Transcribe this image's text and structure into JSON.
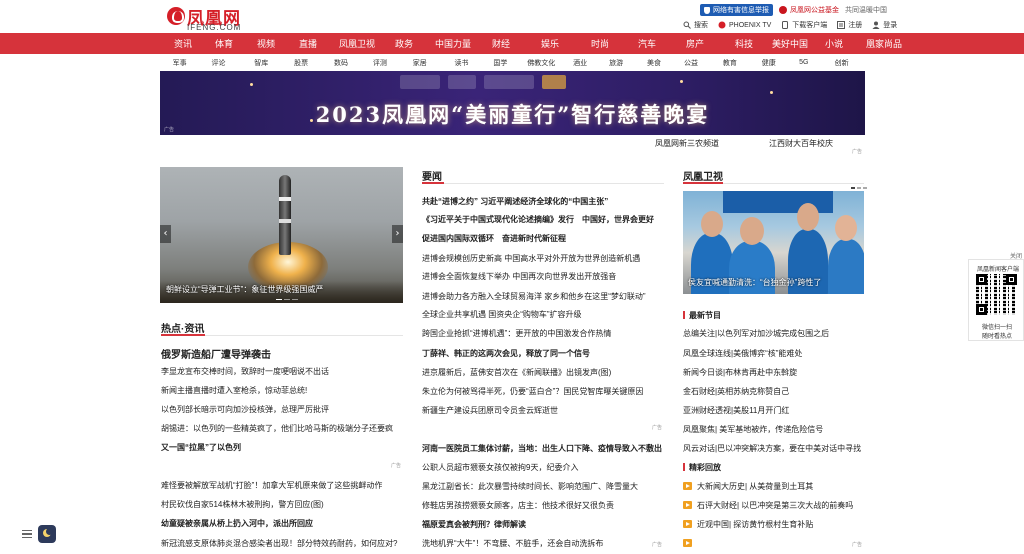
{
  "brand": {
    "logo_text": "凤凰网",
    "logo_sub": "IFENG.COM",
    "color": "#d51f28"
  },
  "top_badges": {
    "report": "网络有害信息举报",
    "fund": "凤凰网公益基金",
    "fund_sub": "共同温暖中国"
  },
  "top_links": [
    {
      "label": "搜索",
      "icon": "search-icon"
    },
    {
      "label": "PHOENIX TV",
      "icon": "phoenix-tv-icon"
    },
    {
      "label": "下载客户端",
      "icon": "download-icon"
    },
    {
      "label": "注册",
      "icon": "register-icon"
    },
    {
      "label": "登录",
      "icon": "user-icon"
    }
  ],
  "nav": [
    "资讯",
    "体育",
    "视频",
    "直播",
    "凤凰卫视",
    "政务",
    "中国力量",
    "财经",
    "娱乐",
    "时尚",
    "汽车",
    "房产",
    "科技",
    "美好中国",
    "小说",
    "凰家尚品"
  ],
  "subnav": [
    "军事",
    "评论",
    "智库",
    "股票",
    "数码",
    "评测",
    "家居",
    "读书",
    "国学",
    "佛教文化",
    "酒业",
    "旅游",
    "美食",
    "公益",
    "教育",
    "健康",
    "5G",
    "创新"
  ],
  "banner": {
    "title": "2023凤凰网“美丽童行”智行慈善晚宴",
    "ad": "广告"
  },
  "banner_links": [
    "凤凰网新三农频道",
    "江西财大百年校庆"
  ],
  "ad_label": "广告",
  "hero": {
    "caption": "朝鲜设立“导弹工业节”：象征世界级强国威严"
  },
  "hot": {
    "title": "热点·资讯",
    "items": [
      "俄罗斯造船厂遭导弹袭击",
      "李显龙宣布交棒时间，致辞时一度哽咽说不出话",
      "新闻主播直播时遭入室枪杀，惊动菲总统!",
      "以色列部长暗示可向加沙投核弹，总理严厉批评",
      "胡锡进：以色列的一些精英疯了，他们比哈马斯的极端分子还要疯",
      "又一国“拉黑”了以色列",
      "难怪要被解放军战机“打脸”！加拿大军机原来做了这些挑衅动作",
      "村民砍伐自家514株林木被刑拘，警方回应(图)",
      "幼童疑被亲属从桥上扔入河中，派出所回应",
      "新冠流感支原体肺炎混合感染者出现！部分特效药耐药，如何应对?"
    ]
  },
  "news": {
    "title": "要闻",
    "items": [
      "共赴“进博之约” 习近平阐述经济全球化的“中国主张”",
      "《习近平关于中国式现代化论述摘编》发行　中国好，世界会更好",
      "促进国内国际双循环　奋进新时代新征程",
      "进博会规模创历史新高 中国高水平对外开放为世界创造新机遇",
      "进博会全面恢复线下举办 中国再次向世界发出开放强音",
      "进博会助力各方融入全球贸易海洋 家乡和他乡在这里“梦幻联动”",
      "全球企业共享机遇 国资央企“购物车”扩容升级",
      "跨国企业抢抓“进博机遇”：更开放的中国激发合作热情",
      "丁薛祥、韩正的这两次会见，释放了同一个信号",
      "进京履新后，蓝佛安首次在《新闻联播》出镜发声(图)",
      "朱立伦为何被骂得半死，仍要“蓝白合”？国民党智库曝关键原因",
      "新疆生产建设兵团原司令员金云辉逝世",
      "河南一医院员工集体讨薪，当地：出生人口下降、疫情导致入不敷出",
      "公职人员超市猥亵女孩仅被拘9天，纪委介入",
      "黑龙江副省长：此次暴雪持续时间长、影响范围广、降雪量大",
      "修鞋店男孩捞猥亵女顾客，店主：他技术很好又很负责",
      "福原爱真会被判刑？律师解读",
      "洗地机界“大牛”！不弯腰、不脏手，还会自动洗拆布"
    ]
  },
  "tv": {
    "title": "凤凰卫视",
    "caption": "侯友宜喊通勤清洗：“台独金孙”跨性了",
    "latest_title": "最新节目",
    "latest": [
      "总编关注|以色列军对加沙城完成包围之后",
      "凤凰全球连线|美俄博弈“核”能难处",
      "新闻今日谈|布林肯再赴中东斡旋",
      "金石财经|英相苏纳克称赞自己",
      "亚洲财经透视|美股11月开门红",
      "凤凰聚焦| 美军基地被炸，传递危险信号",
      "风云对话|巴以冲突解决方案，要在中美对话中寻找"
    ],
    "replay_title": "精彩回放",
    "replay": [
      "大新闻大历史| 从美荷量到土耳其",
      "石评大财经| 以巴冲突是第三次大战的前奏吗",
      "近观中国| 探访黄竹根村生育补贴"
    ]
  },
  "qr": {
    "close": "关闭",
    "title": "凤凰新闻客户端",
    "line1": "微信扫一扫",
    "line2": "随时看热点"
  }
}
